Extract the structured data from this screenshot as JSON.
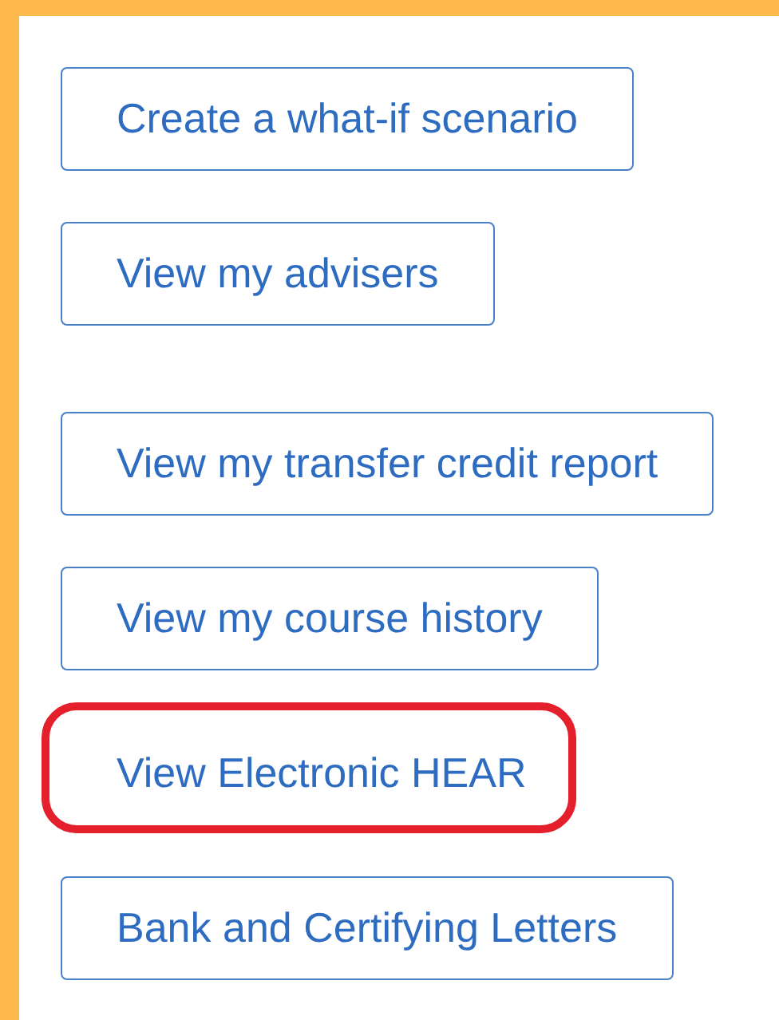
{
  "groups": [
    {
      "buttons": [
        {
          "label": "Create a what-if scenario",
          "highlighted": false
        },
        {
          "label": "View my advisers",
          "highlighted": false
        }
      ]
    },
    {
      "buttons": [
        {
          "label": "View my transfer credit report",
          "highlighted": false
        },
        {
          "label": "View my course history",
          "highlighted": false
        },
        {
          "label": "View Electronic HEAR",
          "highlighted": true
        },
        {
          "label": "Bank and Certifying Letters",
          "highlighted": false
        }
      ]
    }
  ]
}
